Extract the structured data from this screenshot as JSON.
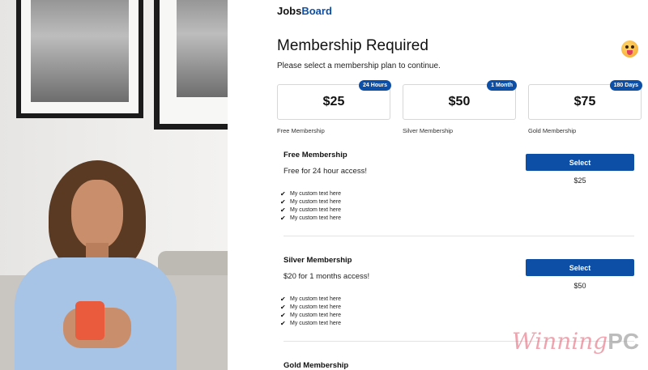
{
  "brand": {
    "part1": "Jobs",
    "part2": "Board",
    "accent": "#0d4ea6"
  },
  "header": {
    "title": "Membership Required",
    "subtitle": "Please select a membership plan to continue.",
    "avatar_icon": "tongue-out-emoji-icon"
  },
  "plans": [
    {
      "price": "$25",
      "badge": "24 Hours",
      "name": "Free Membership"
    },
    {
      "price": "$50",
      "badge": "1 Month",
      "name": "Silver Membership"
    },
    {
      "price": "$75",
      "badge": "180 Days",
      "name": "Gold Membership"
    }
  ],
  "sections": [
    {
      "title": "Free Membership",
      "description": "Free for 24 hour access!",
      "button": "Select",
      "price": "$25",
      "features": [
        "My custom text here",
        "My custom text here",
        "My custom text here",
        "My custom text here"
      ]
    },
    {
      "title": "Silver Membership",
      "description": "$20 for 1 months access!",
      "button": "Select",
      "price": "$50",
      "features": [
        "My custom text here",
        "My custom text here",
        "My custom text here",
        "My custom text here"
      ]
    },
    {
      "title": "Gold Membership"
    }
  ],
  "watermark": {
    "part1": "Winning",
    "part2": "PC"
  },
  "colors": {
    "primary": "#0d4ea6",
    "border": "#d7d7d7"
  }
}
